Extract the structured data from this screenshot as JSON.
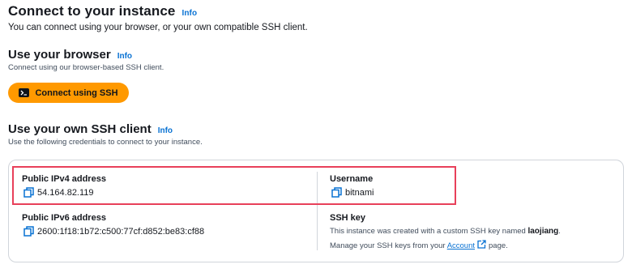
{
  "connect": {
    "title": "Connect to your instance",
    "info": "Info",
    "subtitle": "You can connect using your browser, or your own compatible SSH client."
  },
  "browser": {
    "title": "Use your browser",
    "info": "Info",
    "subtitle": "Connect using our browser-based SSH client.",
    "button_label": "Connect using SSH",
    "button_icon": "terminal-icon",
    "button_color": "#ff9900"
  },
  "own_client": {
    "title": "Use your own SSH client",
    "info": "Info",
    "subtitle": "Use the following credentials to connect to your instance."
  },
  "credentials": {
    "ipv4_label": "Public IPv4 address",
    "ipv4_value": "54.164.82.119",
    "username_label": "Username",
    "username_value": "bitnami",
    "ipv6_label": "Public IPv6 address",
    "ipv6_value": "2600:1f18:1b72:c500:77cf:d852:be83:cf88",
    "ssh_key_label": "SSH key",
    "ssh_key_text": "This instance was created with a custom SSH key named",
    "ssh_key_name": "laojiang",
    "ssh_key_period": ".",
    "manage_prefix": "Manage your SSH keys from your",
    "manage_link": "Account",
    "manage_suffix": "page.",
    "copy_icon": "copy-icon",
    "external_icon": "external-link-icon",
    "link_color": "#0972d3",
    "highlight_color": "#e8405a"
  }
}
